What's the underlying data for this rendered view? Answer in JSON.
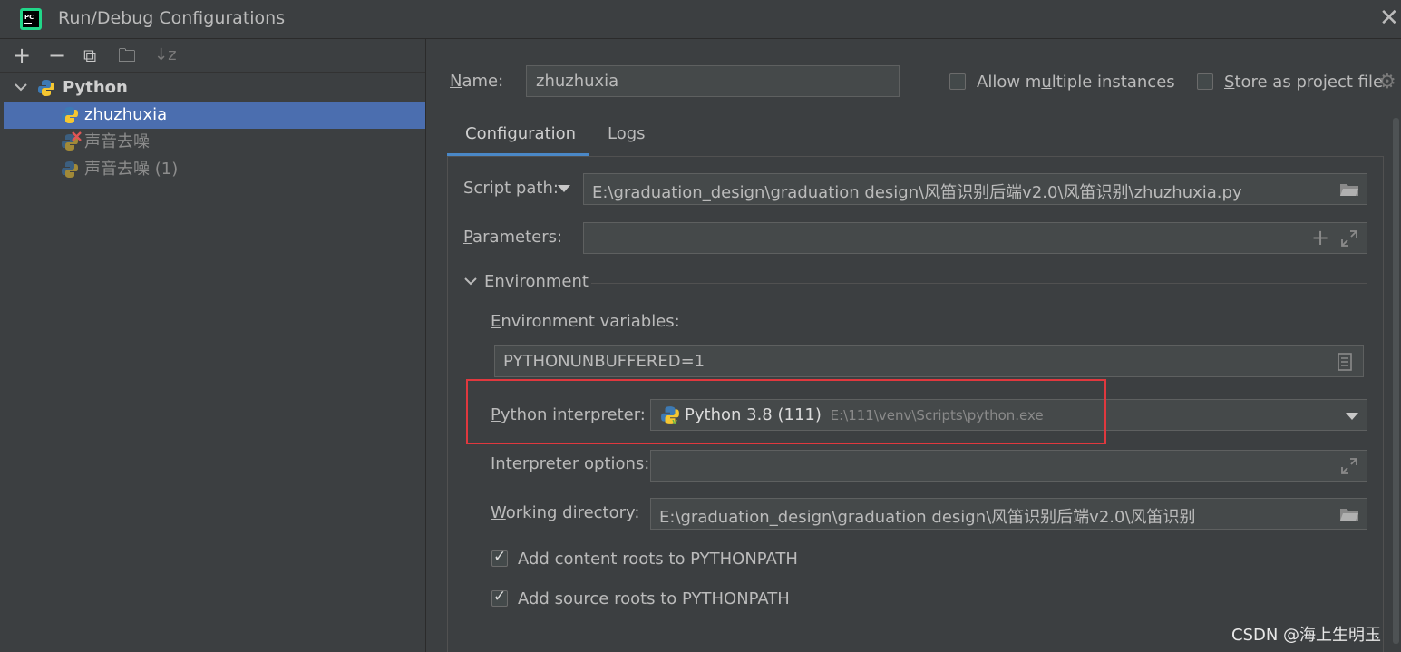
{
  "window": {
    "title": "Run/Debug Configurations"
  },
  "toolbar": {
    "add": "+",
    "remove": "−",
    "copy": "⧉",
    "new_folder": "🗀",
    "sort": "↓z"
  },
  "tree": {
    "group": "Python",
    "items": [
      {
        "label": "zhuzhuxia",
        "selected": true
      },
      {
        "label": "声音去噪",
        "error": true
      },
      {
        "label": "声音去噪 (1)"
      }
    ]
  },
  "header": {
    "name_label_pre": "",
    "name_label_u": "N",
    "name_label_post": "ame:",
    "name_value": "zhuzhuxia",
    "allow_multiple_pre": "Allow m",
    "allow_multiple_u": "u",
    "allow_multiple_post": "ltiple instances",
    "store_pre": "",
    "store_u": "S",
    "store_post": "tore as project file"
  },
  "tabs": [
    {
      "label": "Configuration",
      "active": true
    },
    {
      "label": "Logs"
    }
  ],
  "form": {
    "script_path_label": "Script path:",
    "script_path_value": "E:\\graduation_design\\graduation design\\风笛识别后端v2.0\\风笛识别\\zhuzhuxia.py",
    "parameters_label_u": "P",
    "parameters_label_post": "arameters:",
    "parameters_value": "",
    "environment_section": "Environment",
    "env_vars_label_u": "E",
    "env_vars_label_post": "nvironment variables:",
    "env_vars_value": "PYTHONUNBUFFERED=1",
    "interpreter_label_u": "P",
    "interpreter_label_post": "ython interpreter:",
    "interpreter_name": "Python 3.8 (111)",
    "interpreter_path": "E:\\111\\venv\\Scripts\\python.exe",
    "interpreter_options_label": "Interpreter options:",
    "interpreter_options_value": "",
    "working_dir_label_u": "W",
    "working_dir_label_post": "orking directory:",
    "working_dir_value": "E:\\graduation_design\\graduation design\\风笛识别后端v2.0\\风笛识别",
    "add_content_roots": {
      "label": "Add content roots to PYTHONPATH",
      "checked": true
    },
    "add_source_roots": {
      "label": "Add source roots to PYTHONPATH",
      "checked": true
    }
  },
  "watermark": "CSDN @海上生明玉",
  "colors": {
    "background": "#3c3f41",
    "selection": "#4b6eaf",
    "tab_accent": "#4a88c7",
    "highlight_box": "#e0383e"
  }
}
